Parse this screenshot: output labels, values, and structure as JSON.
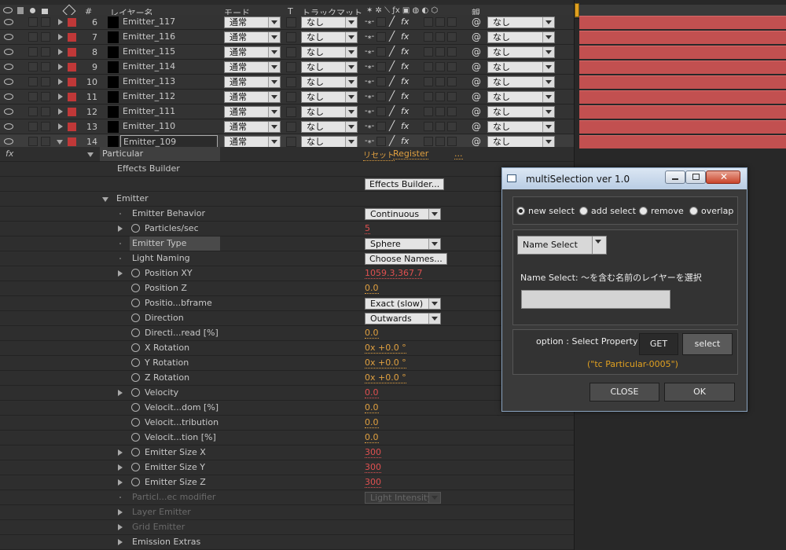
{
  "header": {
    "col_num": "#",
    "col_name": "レイヤー名",
    "col_mode": "モード",
    "col_t": "T",
    "col_track": "トラックマット",
    "col_parent": "親"
  },
  "layers": [
    {
      "num": "6",
      "name": "Emitter_117",
      "mode": "通常",
      "track": "なし",
      "parent": "なし"
    },
    {
      "num": "7",
      "name": "Emitter_116",
      "mode": "通常",
      "track": "なし",
      "parent": "なし"
    },
    {
      "num": "8",
      "name": "Emitter_115",
      "mode": "通常",
      "track": "なし",
      "parent": "なし"
    },
    {
      "num": "9",
      "name": "Emitter_114",
      "mode": "通常",
      "track": "なし",
      "parent": "なし"
    },
    {
      "num": "10",
      "name": "Emitter_113",
      "mode": "通常",
      "track": "なし",
      "parent": "なし"
    },
    {
      "num": "11",
      "name": "Emitter_112",
      "mode": "通常",
      "track": "なし",
      "parent": "なし"
    },
    {
      "num": "12",
      "name": "Emitter_111",
      "mode": "通常",
      "track": "なし",
      "parent": "なし"
    },
    {
      "num": "13",
      "name": "Emitter_110",
      "mode": "通常",
      "track": "なし",
      "parent": "なし"
    },
    {
      "num": "14",
      "name": "Emitter_109",
      "mode": "通常",
      "track": "なし",
      "parent": "なし"
    }
  ],
  "effect": {
    "fx": "fx",
    "name": "Particular",
    "reset": "リセット",
    "register": "Register",
    "more": "..."
  },
  "props": [
    {
      "label": "Effects Builder",
      "indent": 1,
      "tri": "none",
      "sw": false,
      "dim": false
    },
    {
      "label": "",
      "indent": 1,
      "tri": "none",
      "sw": false,
      "dim": false,
      "button": "Effects Builder..."
    },
    {
      "label": "Emitter",
      "indent": 0,
      "tri": "down",
      "sw": false,
      "dim": false
    },
    {
      "label": "Emitter Behavior",
      "indent": 2,
      "tri": "none",
      "sw": false,
      "dim": false,
      "dropdown": "Continuous"
    },
    {
      "label": "Particles/sec",
      "indent": 2,
      "tri": "right",
      "sw": true,
      "dim": false,
      "value": "5",
      "red": true
    },
    {
      "label": "Emitter Type",
      "indent": 2,
      "tri": "none",
      "sw": false,
      "dim": false,
      "dropdown": "Sphere",
      "hl": true
    },
    {
      "label": "Light Naming",
      "indent": 2,
      "tri": "none",
      "sw": false,
      "dim": false,
      "button": "Choose Names..."
    },
    {
      "label": "Position XY",
      "indent": 2,
      "tri": "right",
      "sw": true,
      "dim": false,
      "value": "1059.3,367.7",
      "red": true
    },
    {
      "label": "Position Z",
      "indent": 2,
      "tri": "none",
      "sw": true,
      "dim": false,
      "value": "0.0"
    },
    {
      "label": "Positio...bframe",
      "indent": 2,
      "tri": "none",
      "sw": true,
      "dim": false,
      "dropdown": "Exact (slow)"
    },
    {
      "label": "Direction",
      "indent": 2,
      "tri": "none",
      "sw": true,
      "dim": false,
      "dropdown": "Outwards"
    },
    {
      "label": "Directi...read [%]",
      "indent": 2,
      "tri": "none",
      "sw": true,
      "dim": false,
      "value": "0.0"
    },
    {
      "label": "X Rotation",
      "indent": 2,
      "tri": "none",
      "sw": true,
      "dim": false,
      "value": "0x +0.0 °"
    },
    {
      "label": "Y Rotation",
      "indent": 2,
      "tri": "none",
      "sw": true,
      "dim": false,
      "value": "0x +0.0 °"
    },
    {
      "label": "Z Rotation",
      "indent": 2,
      "tri": "none",
      "sw": true,
      "dim": false,
      "value": "0x +0.0 °"
    },
    {
      "label": "Velocity",
      "indent": 2,
      "tri": "right",
      "sw": true,
      "dim": false,
      "value": "0.0",
      "red": true
    },
    {
      "label": "Velocit...dom [%]",
      "indent": 2,
      "tri": "none",
      "sw": true,
      "dim": false,
      "value": "0.0"
    },
    {
      "label": "Velocit...tribution",
      "indent": 2,
      "tri": "none",
      "sw": true,
      "dim": false,
      "value": "0.0"
    },
    {
      "label": "Velocit...tion [%]",
      "indent": 2,
      "tri": "none",
      "sw": true,
      "dim": false,
      "value": "0.0"
    },
    {
      "label": "Emitter Size X",
      "indent": 2,
      "tri": "right",
      "sw": true,
      "dim": false,
      "value": "300",
      "red": true
    },
    {
      "label": "Emitter Size Y",
      "indent": 2,
      "tri": "right",
      "sw": true,
      "dim": false,
      "value": "300",
      "red": true
    },
    {
      "label": "Emitter Size Z",
      "indent": 2,
      "tri": "right",
      "sw": true,
      "dim": false,
      "value": "300",
      "red": true
    },
    {
      "label": "Particl...ec modifier",
      "indent": 2,
      "tri": "none",
      "sw": false,
      "dim": true,
      "dropdown": "Light Intensity"
    },
    {
      "label": "Layer Emitter",
      "indent": 2,
      "tri": "right",
      "sw": false,
      "dim": true
    },
    {
      "label": "Grid Emitter",
      "indent": 2,
      "tri": "right",
      "sw": false,
      "dim": true
    },
    {
      "label": "Emission Extras",
      "indent": 2,
      "tri": "right",
      "sw": false,
      "dim": false
    }
  ],
  "dialog": {
    "title": "multiSelection ver 1.0",
    "modes": [
      {
        "label": "new select",
        "on": true
      },
      {
        "label": "add select",
        "on": false
      },
      {
        "label": "remove",
        "on": false
      },
      {
        "label": "overlap",
        "on": false
      }
    ],
    "select_type": "Name Select",
    "name_label": "Name Select: ～を含む名前のレイヤーを選択",
    "name_value": "",
    "option_label": "option : Select Property",
    "get": "GET",
    "select": "select",
    "property": "(\"tc Particular-0005\")",
    "close": "CLOSE",
    "ok": "OK"
  },
  "colors": {
    "label_red": "#c03838",
    "bar": "#c25050",
    "value": "#e0a040",
    "value_red": "#e05050"
  }
}
